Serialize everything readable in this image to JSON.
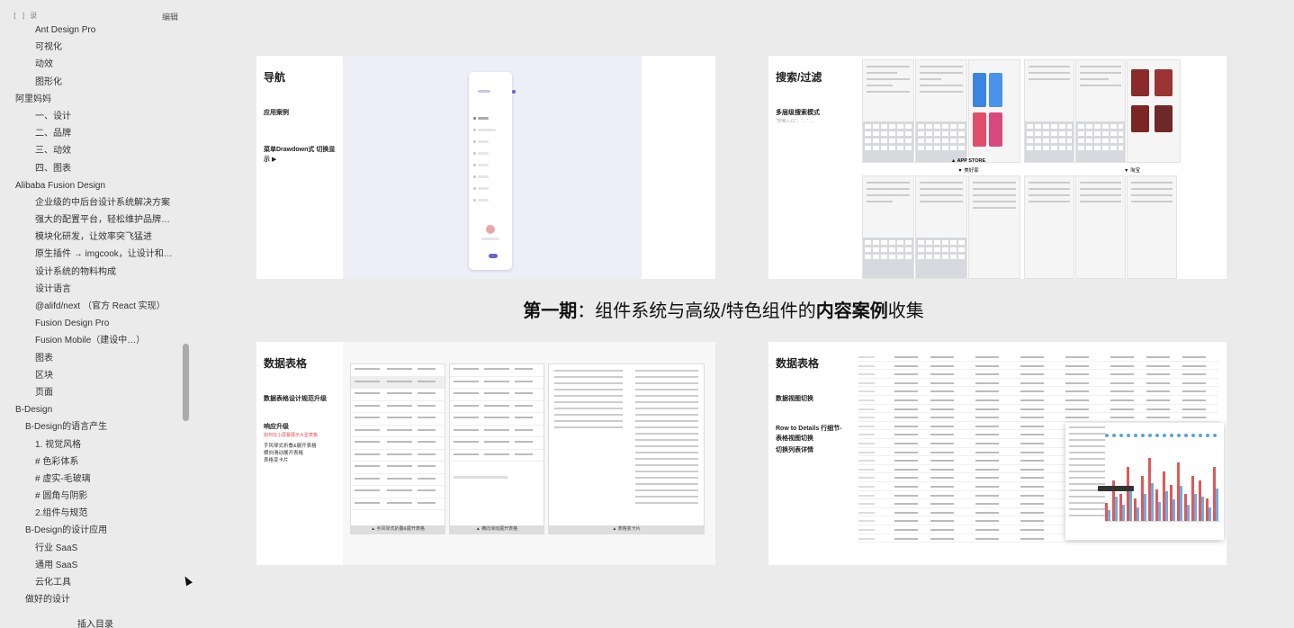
{
  "sidebar": {
    "header_left": "[ ] 录",
    "header_right": "编辑",
    "items": [
      {
        "label": "Ant Design Pro",
        "level": 2
      },
      {
        "label": "可视化",
        "level": 2
      },
      {
        "label": "动效",
        "level": 2
      },
      {
        "label": "图形化",
        "level": 2
      },
      {
        "label": "阿里妈妈",
        "level": 0
      },
      {
        "label": "一、设计",
        "level": 2
      },
      {
        "label": "二、品牌",
        "level": 2
      },
      {
        "label": "三、动效",
        "level": 2
      },
      {
        "label": "四、图表",
        "level": 2
      },
      {
        "label": "Alibaba Fusion Design",
        "level": 0
      },
      {
        "label": "企业级的中后台设计系统解决方案",
        "level": 2
      },
      {
        "label": "强大的配置平台，轻松维护品牌…",
        "level": 2
      },
      {
        "label": "模块化研发，让效率突飞猛进",
        "level": 2
      },
      {
        "label": "原生插件 → imgcook，让设计和…",
        "level": 2
      },
      {
        "label": "设计系统的物料构成",
        "level": 2
      },
      {
        "label": "设计语言",
        "level": 2
      },
      {
        "label": "@alifd/next （官方 React 实现）",
        "level": 2
      },
      {
        "label": "Fusion Design Pro",
        "level": 2
      },
      {
        "label": "Fusion Mobile（建设中…）",
        "level": 2
      },
      {
        "label": "图表",
        "level": 2
      },
      {
        "label": "区块",
        "level": 2
      },
      {
        "label": "页面",
        "level": 2
      },
      {
        "label": "B-Design",
        "level": 0
      },
      {
        "label": "B-Design的语言产生",
        "level": 1
      },
      {
        "label": "1. 视觉风格",
        "level": 2
      },
      {
        "label": "# 色彩体系",
        "level": 2
      },
      {
        "label": "# 虚实-毛玻璃",
        "level": 2
      },
      {
        "label": "# 圆角与阴影",
        "level": 2
      },
      {
        "label": "2.组件与规范",
        "level": 2
      },
      {
        "label": "B-Design的设计应用",
        "level": 1
      },
      {
        "label": "行业 SaaS",
        "level": 2
      },
      {
        "label": "通用 SaaS",
        "level": 2
      },
      {
        "label": "云化工具",
        "level": 2
      },
      {
        "label": "做好的设计",
        "level": 1
      }
    ],
    "insert_toc": "插入目录"
  },
  "heading": {
    "part1": "第一期",
    "part2": "：组件系统与高级/特色组件的",
    "part3": "内容案例",
    "part4": "收集"
  },
  "cards": {
    "nav": {
      "title": "导航",
      "sec1": "应用案例",
      "sec2": "菜单Drawdown式 切换显示 ▶"
    },
    "search": {
      "title": "搜索/过滤",
      "sec1": "多层级搜索模式",
      "sub1": "\"搜索入口\"、\"...\" ...",
      "caption1": "▲ APP STORE",
      "caption2": "▼ 美好家",
      "caption3": "▼ 淘宝"
    },
    "table1": {
      "title": "数据表格",
      "sec1": "数据表格设计规范升级",
      "sec2": "响应升级",
      "red": "如何在小屏幕展示大型表格",
      "line1": "手风琴式折叠&展开表格",
      "line2": "横向滑动展开表格",
      "line3": "表格变卡片",
      "cap1": "▲ 手风琴式折叠&展开表格",
      "cap2": "▲ 横向滑动展开表格",
      "cap3": "▲ 表格变卡片"
    },
    "table2": {
      "title": "数据表格",
      "sec1": "数据视图切换",
      "sec2": "Row to Details 行细节-表格视图切换",
      "sec3": "切换列表详情"
    }
  }
}
